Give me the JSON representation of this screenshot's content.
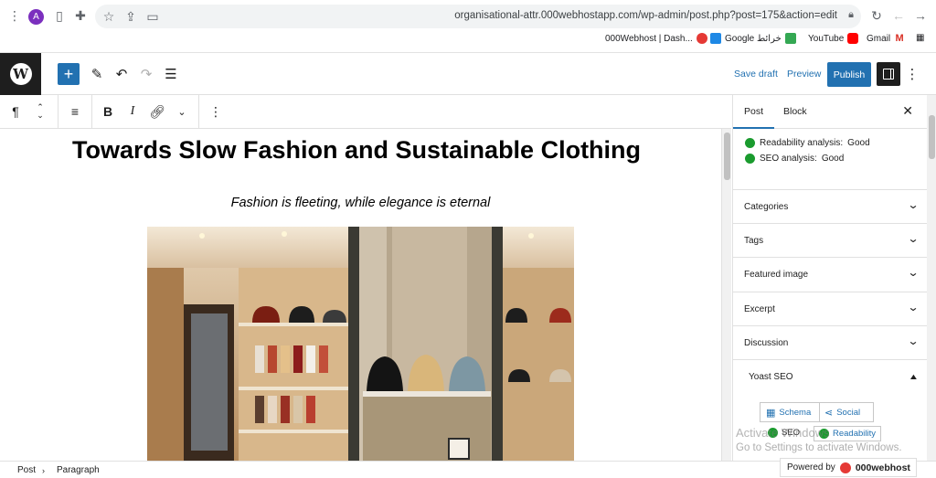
{
  "browser": {
    "url": "organisational-attr.000webhostapp.com/wp-admin/post.php?post=175&action=edit",
    "profile_initial": "A",
    "bookmarks": [
      {
        "label": "000Webhost | Dash...",
        "color": "#e53935"
      },
      {
        "label": "Google خرائط",
        "color": "#1e88e5"
      },
      {
        "label": "YouTube",
        "color": "#ff0000"
      },
      {
        "label": "Gmail",
        "color": "#d93025"
      }
    ]
  },
  "editor_header": {
    "save_draft": "Save draft",
    "preview": "Preview",
    "publish": "Publish"
  },
  "block_toolbar": {
    "paragraph_symbol": "¶",
    "bold": "B",
    "italic": "I"
  },
  "content": {
    "title": "Towards Slow Fashion and Sustainable Clothing",
    "quote": "Fashion is fleeting, while elegance is eternal"
  },
  "sidebar": {
    "tabs": [
      "Post",
      "Block"
    ],
    "readability_label": "Readability analysis:",
    "readability_value": "Good",
    "seo_label": "SEO analysis:",
    "seo_value": "Good",
    "panels": [
      "Categories",
      "Tags",
      "Featured image",
      "Excerpt",
      "Discussion"
    ],
    "yoast_title": "Yoast SEO",
    "yoast_tabs": [
      "Schema",
      "Social",
      "SEO",
      "Readability"
    ]
  },
  "watermark": {
    "line1": "Activate Windows",
    "line2": "Go to Settings to activate Windows."
  },
  "footer": {
    "breadcrumb": [
      "Post",
      "Paragraph"
    ],
    "powered_by": "Powered by",
    "brand": "000webhost"
  },
  "colors": {
    "accent": "#2271b1",
    "good": "#1a9b2e"
  }
}
